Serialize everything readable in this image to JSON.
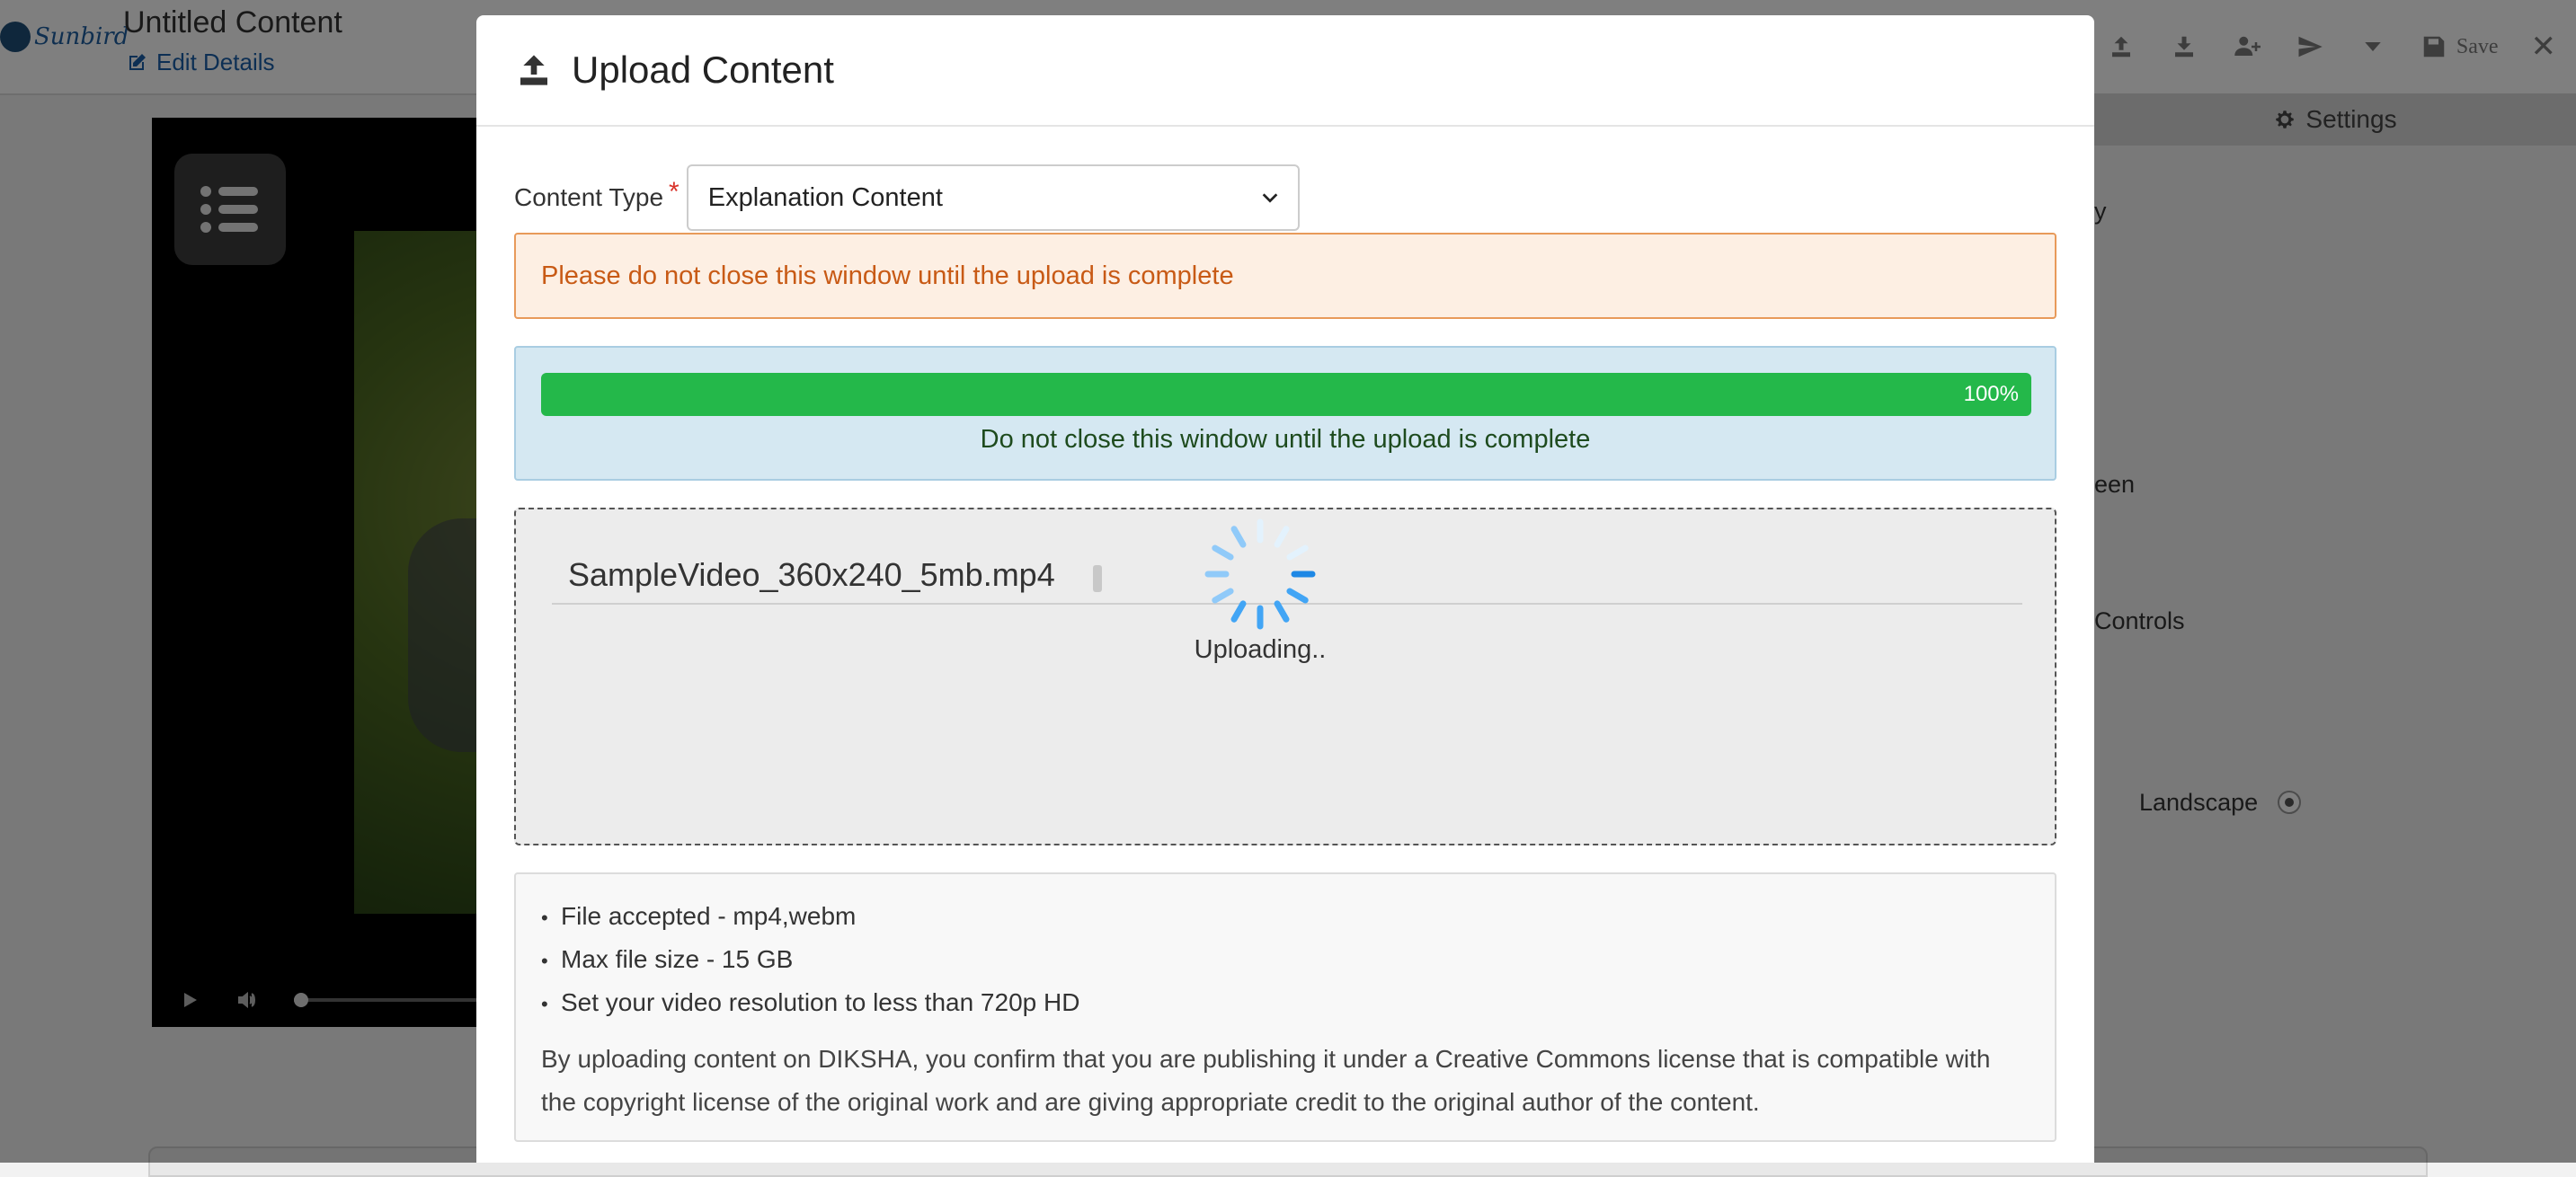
{
  "app": {
    "logo_text": "Sunbird",
    "title": "Untitled Content",
    "edit_details": "Edit Details",
    "save_label": "Save"
  },
  "settings": {
    "header": "Settings",
    "partial_labels": [
      "y",
      "een",
      "Controls",
      "Landscape"
    ]
  },
  "modal": {
    "title": "Upload Content",
    "content_type_label": "Content Type",
    "required_mark": "*",
    "content_type_value": "Explanation Content",
    "warning": "Please do not close this window until the upload is complete",
    "progress": {
      "percent": 100,
      "percent_label": "100%",
      "message": "Do not close this window until the upload is complete"
    },
    "file": {
      "name": "SampleVideo_360x240_5mb.mp4",
      "status": "Uploading.."
    },
    "info": {
      "bullets": [
        "File accepted - mp4,webm",
        "Max file size - 15 GB",
        "Set your video resolution to less than 720p HD"
      ],
      "license": "By uploading content on DIKSHA, you confirm that you are publishing it under a Creative Commons license that is compatible with the copyright license of the original work and are giving appropriate credit to the original author of the content."
    }
  },
  "colors": {
    "progress_fill": "#24b84a",
    "warning_text": "#c85a15",
    "link": "#1a5fa8"
  }
}
